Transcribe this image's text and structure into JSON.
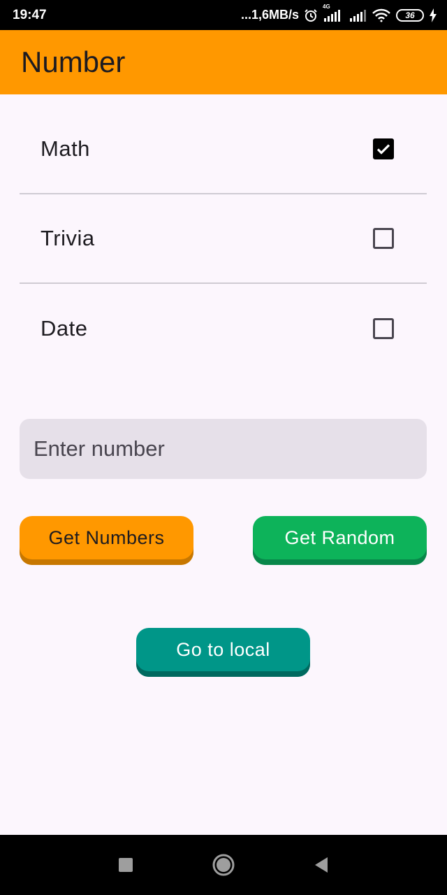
{
  "status_bar": {
    "time": "19:47",
    "network_speed": "...1,6MB/s",
    "network_type": "4G",
    "battery": "36",
    "icons": [
      "alarm-icon",
      "signal-icon",
      "signal-icon",
      "wifi-icon",
      "battery-icon",
      "charging-icon"
    ]
  },
  "app_bar": {
    "title": "Number"
  },
  "options": [
    {
      "label": "Math",
      "checked": true
    },
    {
      "label": "Trivia",
      "checked": false
    },
    {
      "label": "Date",
      "checked": false
    }
  ],
  "input": {
    "placeholder": "Enter number",
    "value": ""
  },
  "buttons": {
    "get_numbers": "Get Numbers",
    "get_random": "Get Random",
    "go_local": "Go to local"
  },
  "colors": {
    "app_bar": "#ff9800",
    "get_numbers": "#ff9800",
    "get_random": "#0db35a",
    "go_local": "#009688",
    "background": "#fcf6fd",
    "input_fill": "#e6e0e9"
  },
  "nav_bar": {
    "icons": [
      "recents-square-icon",
      "home-circle-icon",
      "back-triangle-icon"
    ]
  }
}
